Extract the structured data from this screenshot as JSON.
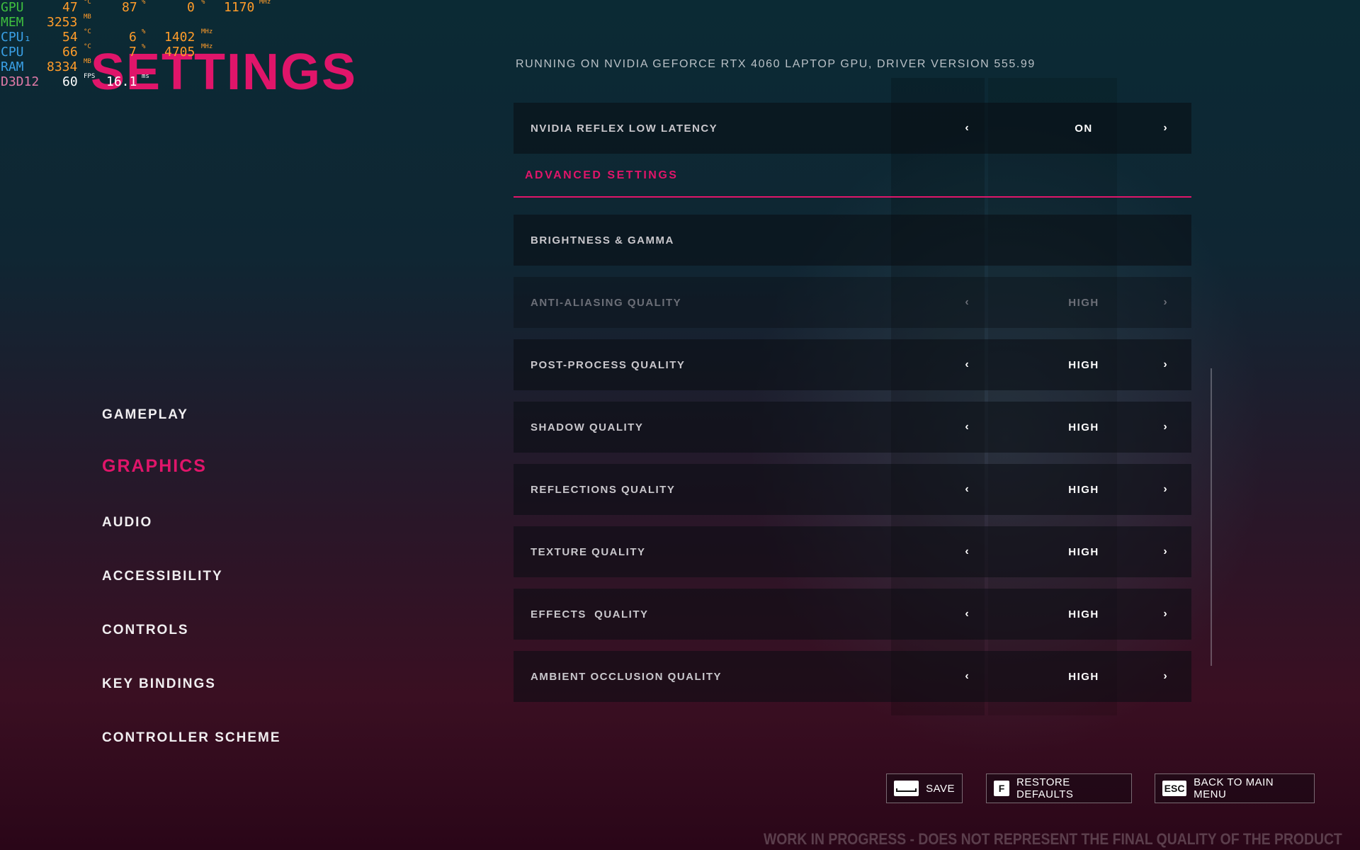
{
  "osd": {
    "rows": [
      {
        "label": "GPU",
        "a": "47",
        "a_unit": "°C",
        "b": "87",
        "b_unit": "%",
        "c": "0",
        "c_unit": "%",
        "d": "1170",
        "d_unit": "MHz"
      },
      {
        "label": "MEM",
        "a": "3253",
        "a_unit": "MB"
      },
      {
        "label": "CPU₁",
        "a": "54",
        "a_unit": "°C",
        "b": "6",
        "b_unit": "%",
        "c": "1402",
        "c_unit": "MHz"
      },
      {
        "label": "CPU",
        "a": "66",
        "a_unit": "°C",
        "b": "7",
        "b_unit": "%",
        "c": "4705",
        "c_unit": "MHz"
      },
      {
        "label": "RAM",
        "a": "8334",
        "a_unit": "MB"
      },
      {
        "label": "D3D12",
        "a": "60",
        "a_unit": "FPS",
        "b": "16.1",
        "b_unit": "ms"
      }
    ]
  },
  "page_title": "SETTINGS",
  "driver_info": "RUNNING ON NVIDIA GEFORCE RTX 4060 LAPTOP GPU, DRIVER VERSION 555.99",
  "nav": {
    "items": [
      {
        "label": "GAMEPLAY"
      },
      {
        "label": "GRAPHICS",
        "active": true
      },
      {
        "label": "AUDIO"
      },
      {
        "label": "ACCESSIBILITY"
      },
      {
        "label": "CONTROLS"
      },
      {
        "label": "KEY BINDINGS"
      },
      {
        "label": "CONTROLLER SCHEME"
      }
    ]
  },
  "settings": {
    "reflex": {
      "label": "NVIDIA REFLEX LOW LATENCY",
      "value": "ON"
    },
    "advanced_header": "ADVANCED SETTINGS",
    "brightness": {
      "label": "BRIGHTNESS & GAMMA"
    },
    "rows": [
      {
        "label": "ANTI-ALIASING QUALITY",
        "value": "HIGH",
        "disabled": true
      },
      {
        "label": "POST-PROCESS QUALITY",
        "value": "HIGH"
      },
      {
        "label": "SHADOW QUALITY",
        "value": "HIGH"
      },
      {
        "label": "REFLECTIONS QUALITY",
        "value": "HIGH"
      },
      {
        "label": "TEXTURE QUALITY",
        "value": "HIGH"
      },
      {
        "label": "EFFECTS  QUALITY",
        "value": "HIGH"
      },
      {
        "label": "AMBIENT OCCLUSION QUALITY",
        "value": "HIGH"
      }
    ],
    "arrow_left": "‹",
    "arrow_right": "›"
  },
  "actions": {
    "save": {
      "key": "",
      "label": "SAVE"
    },
    "restore": {
      "key": "F",
      "label": "RESTORE DEFAULTS"
    },
    "back": {
      "key": "ESC",
      "label": "BACK TO MAIN MENU"
    }
  },
  "footer_notice": "WORK IN PROGRESS - DOES NOT REPRESENT THE FINAL QUALITY OF THE PRODUCT",
  "colors": {
    "accent": "#e0156a",
    "text": "#c9c7cc"
  }
}
